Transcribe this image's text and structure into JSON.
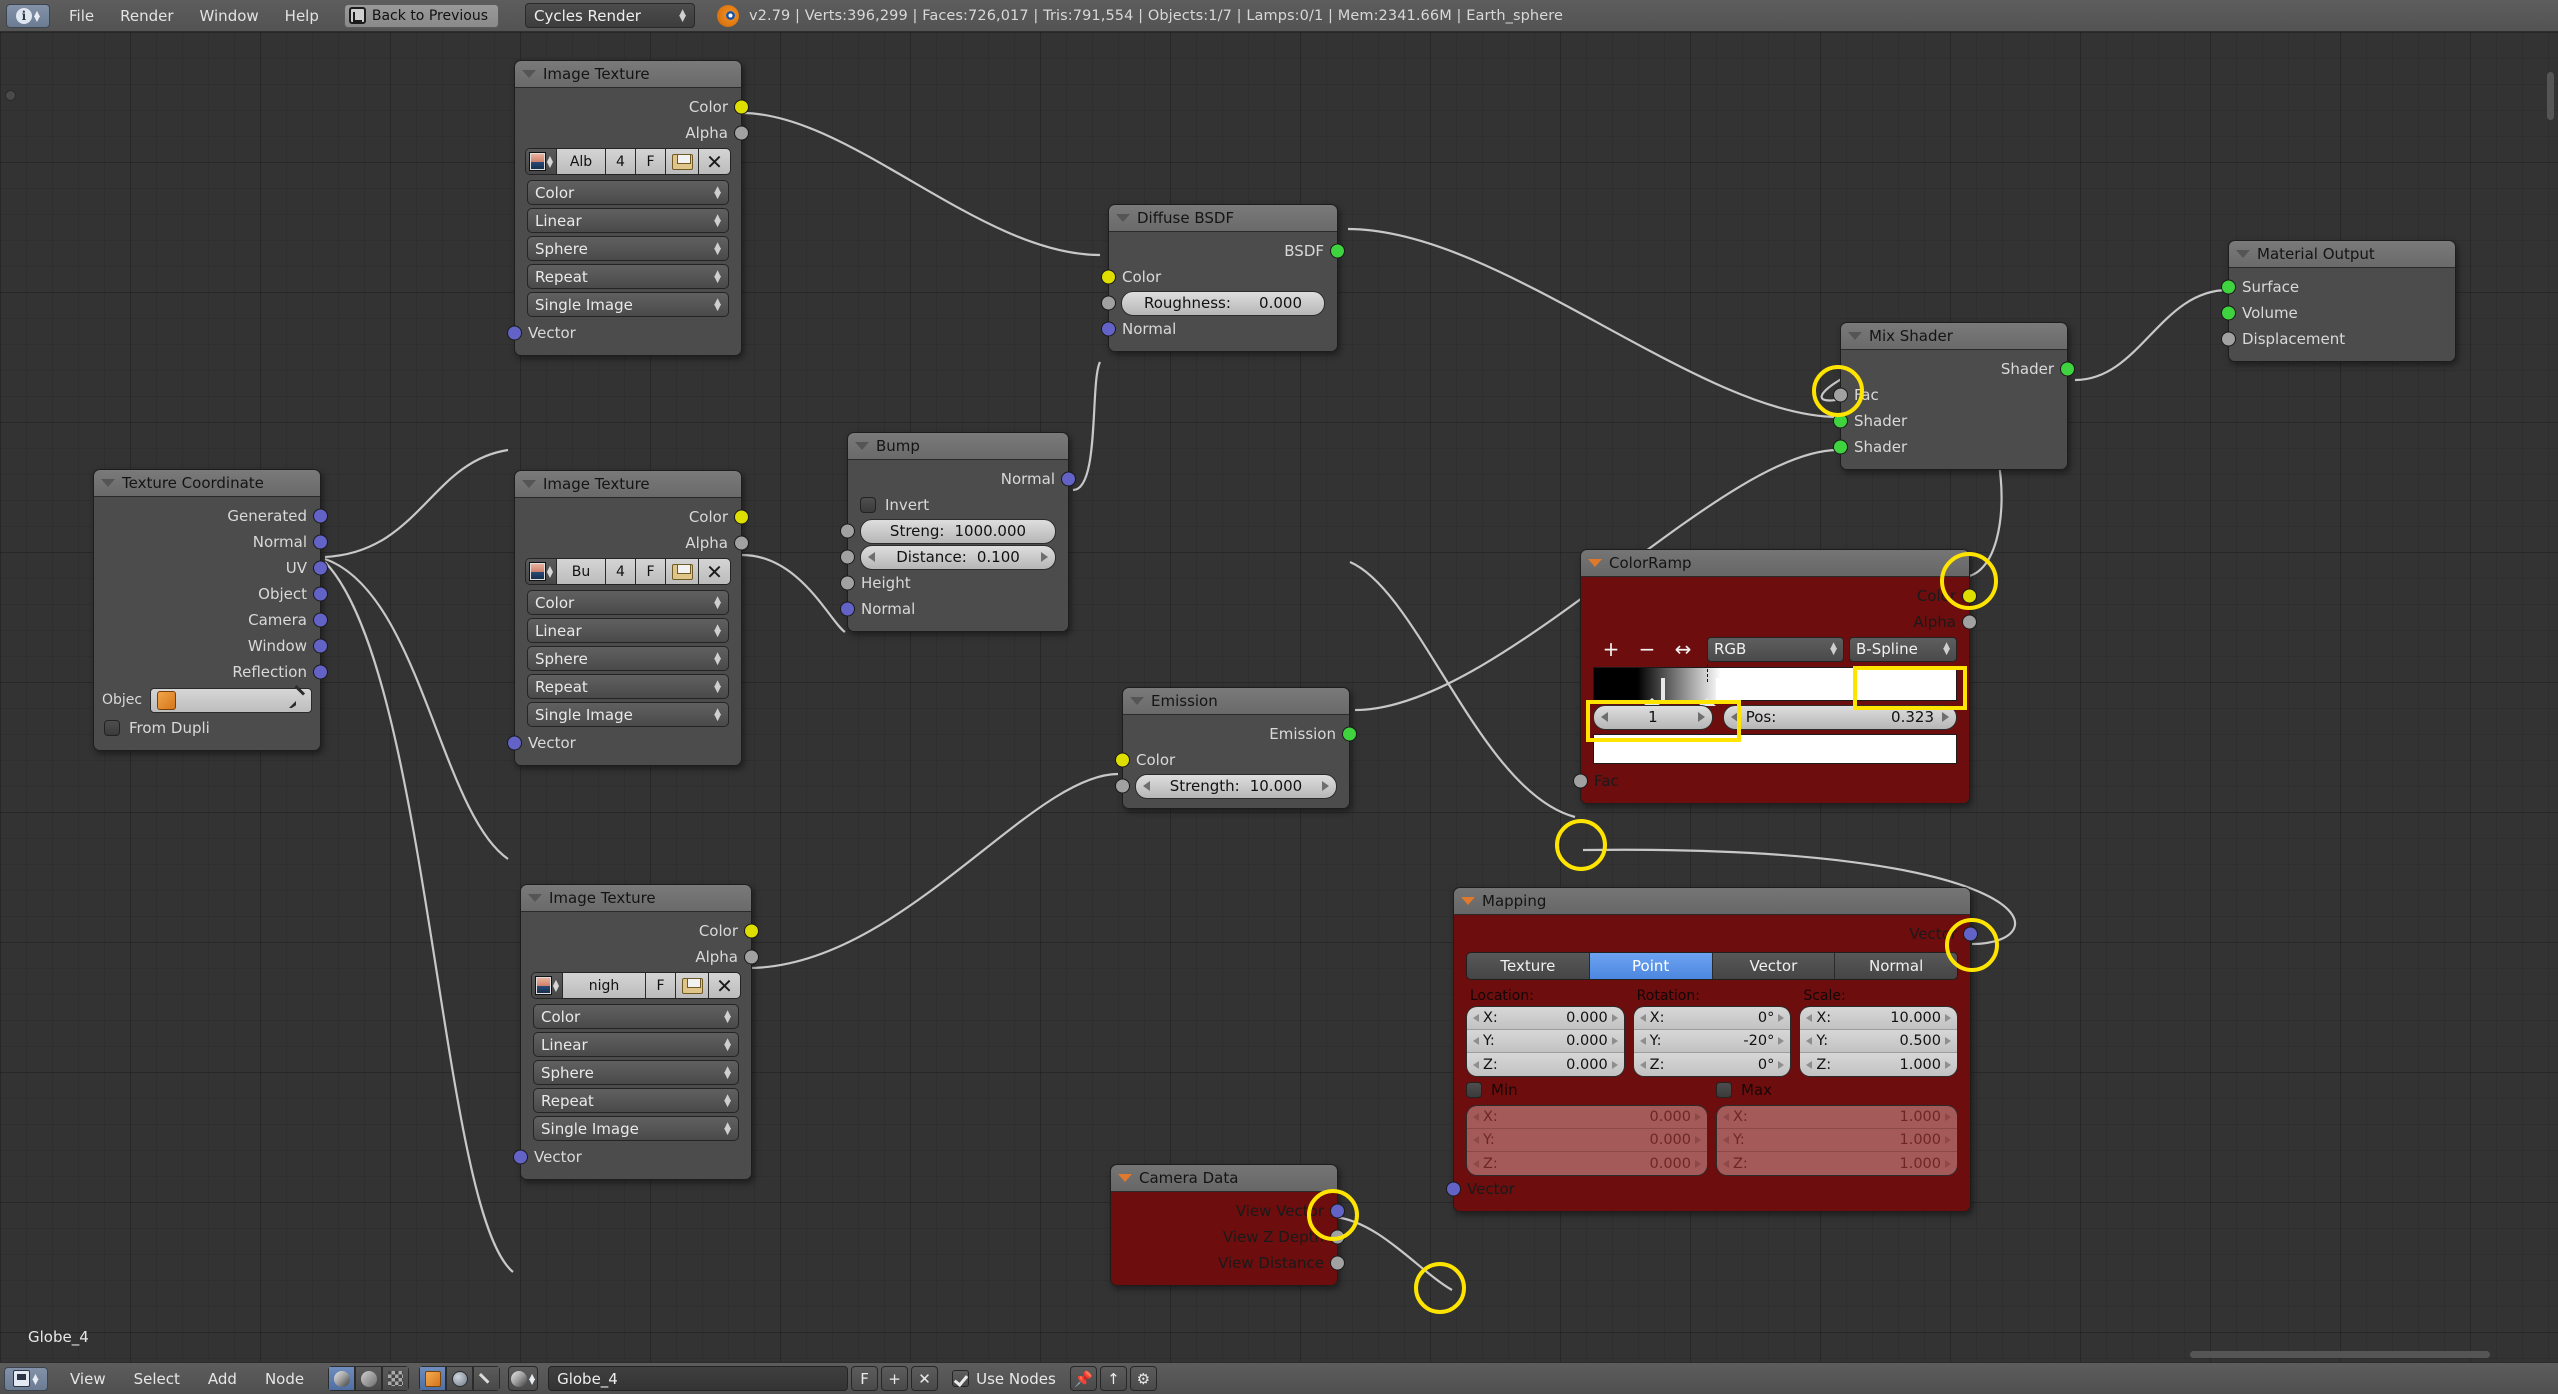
{
  "header": {
    "editor_type_icon": "info-editor-icon",
    "menus": [
      "File",
      "Render",
      "Window",
      "Help"
    ],
    "back_to_previous": "Back to Previous",
    "render_engine": "Cycles Render",
    "logo_icon": "blender-logo-icon",
    "stats": "v2.79 | Verts:396,299 | Faces:726,017 | Tris:791,554 | Objects:1/7 | Lamps:0/1 | Mem:2341.66M | Earth_sphere"
  },
  "canvas": {
    "active_object_label": "Globe_4"
  },
  "nodes": {
    "image_texture_1": {
      "title": "Image Texture",
      "outputs": [
        "Color",
        "Alpha"
      ],
      "image_name": "Alb",
      "image_users": "4",
      "fake_user": "F",
      "dropdowns": [
        "Color",
        "Linear",
        "Sphere",
        "Repeat",
        "Single Image"
      ],
      "inputs": [
        "Vector"
      ]
    },
    "image_texture_2": {
      "title": "Image Texture",
      "outputs": [
        "Color",
        "Alpha"
      ],
      "image_name": "Bu",
      "image_users": "4",
      "fake_user": "F",
      "dropdowns": [
        "Color",
        "Linear",
        "Sphere",
        "Repeat",
        "Single Image"
      ],
      "inputs": [
        "Vector"
      ]
    },
    "image_texture_3": {
      "title": "Image Texture",
      "outputs": [
        "Color",
        "Alpha"
      ],
      "image_name": "nigh",
      "fake_user": "F",
      "dropdowns": [
        "Color",
        "Linear",
        "Sphere",
        "Repeat",
        "Single Image"
      ],
      "inputs": [
        "Vector"
      ]
    },
    "texture_coordinate": {
      "title": "Texture Coordinate",
      "outputs": [
        "Generated",
        "Normal",
        "UV",
        "Object",
        "Camera",
        "Window",
        "Reflection"
      ],
      "object_label": "Objec",
      "object_value": "",
      "from_dupli": "From Dupli"
    },
    "diffuse_bsdf": {
      "title": "Diffuse BSDF",
      "outputs": [
        "BSDF"
      ],
      "inputs": [
        "Color",
        "Normal"
      ],
      "roughness_label": "Roughness:",
      "roughness_value": "0.000"
    },
    "bump": {
      "title": "Bump",
      "outputs": [
        "Normal"
      ],
      "invert_label": "Invert",
      "strength_label": "Streng:",
      "strength_value": "1000.000",
      "distance_label": "Distance:",
      "distance_value": "0.100",
      "inputs": [
        "Height",
        "Normal"
      ]
    },
    "emission": {
      "title": "Emission",
      "outputs": [
        "Emission"
      ],
      "inputs": [
        "Color"
      ],
      "strength_label": "Strength:",
      "strength_value": "10.000"
    },
    "mix_shader": {
      "title": "Mix Shader",
      "outputs": [
        "Shader"
      ],
      "inputs": [
        "Fac",
        "Shader",
        "Shader"
      ]
    },
    "material_output": {
      "title": "Material Output",
      "inputs": [
        "Surface",
        "Volume",
        "Displacement"
      ]
    },
    "colorramp": {
      "title": "ColorRamp",
      "outputs": [
        "Color",
        "Alpha"
      ],
      "tool_add": "+",
      "tool_remove": "−",
      "tool_flip": "↔",
      "color_mode": "RGB",
      "interpolation": "B-Spline",
      "index_value": "1",
      "pos_label": "Pos:",
      "pos_value": "0.323",
      "inputs": [
        "Fac"
      ]
    },
    "mapping": {
      "title": "Mapping",
      "outputs": [
        "Vector"
      ],
      "tabs": [
        "Texture",
        "Point",
        "Vector",
        "Normal"
      ],
      "active_tab": "Point",
      "location_label": "Location:",
      "rotation_label": "Rotation:",
      "scale_label": "Scale:",
      "location": {
        "x": "0.000",
        "y": "0.000",
        "z": "0.000"
      },
      "rotation": {
        "x": "0°",
        "y": "-20°",
        "z": "0°"
      },
      "scale": {
        "x": "10.000",
        "y": "0.500",
        "z": "1.000"
      },
      "min_label": "Min",
      "max_label": "Max",
      "min": {
        "x": "0.000",
        "y": "0.000",
        "z": "0.000"
      },
      "max": {
        "x": "1.000",
        "y": "1.000",
        "z": "1.000"
      },
      "axis_x": "X:",
      "axis_y": "Y:",
      "axis_z": "Z:",
      "inputs": [
        "Vector"
      ]
    },
    "camera_data": {
      "title": "Camera Data",
      "outputs": [
        "View Vector",
        "View Z Depth",
        "View Distance"
      ]
    }
  },
  "colors": {
    "node_header": "#6f6f6f",
    "node_body": "#4c4c4c",
    "node_body_red": "#6d0d0d",
    "highlight": "#ffe400",
    "socket_color": "#dede00",
    "socket_shader": "#3fd43f",
    "socket_vector": "#6363c7",
    "socket_value": "#a1a1a1",
    "tab_active": "#4c87e0"
  },
  "bottombar": {
    "editor_icon": "node-editor-icon",
    "menus": [
      "View",
      "Select",
      "Add",
      "Node"
    ],
    "shader_type_icons": [
      "object-shading-icon",
      "world-shading-icon",
      "texture-shading-icon"
    ],
    "context_icons": [
      "object-icon",
      "world-icon",
      "brush-icon"
    ],
    "material_browse_icon": "material-ball-icon",
    "material_name": "Globe_4",
    "fake_user_btn": "F",
    "new_material_btn": "+",
    "unlink_btn": "✕",
    "use_nodes_label": "Use Nodes",
    "pin_icon": "pin-icon",
    "parent_icon": "go-to-parent-icon",
    "snap_icon": "snap-icon"
  }
}
